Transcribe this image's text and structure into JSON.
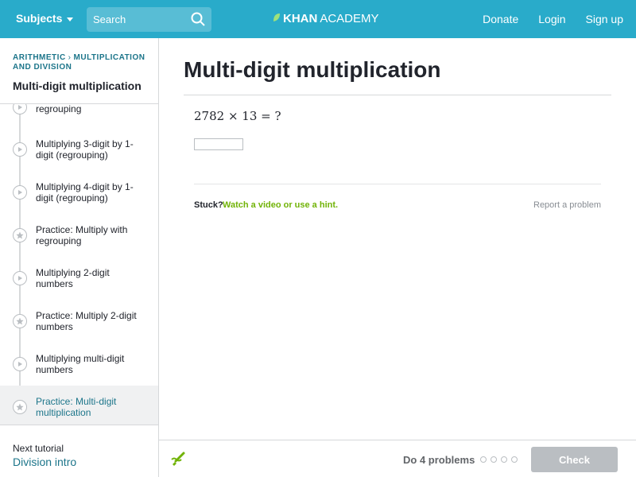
{
  "header": {
    "subjects_label": "Subjects",
    "search_placeholder": "Search",
    "logo_bold": "KHAN",
    "logo_light": "ACADEMY",
    "donate_label": "Donate",
    "login_label": "Login",
    "signup_label": "Sign up",
    "brand_color": "#29abca"
  },
  "sidebar": {
    "breadcrumb_1": "ARITHMETIC",
    "breadcrumb_2": "MULTIPLICATION AND DIVISION",
    "title": "Multi-digit multiplication",
    "items": [
      {
        "label": "regrouping",
        "type": "video"
      },
      {
        "label": "Multiplying 3-digit by 1-digit (regrouping)",
        "type": "video"
      },
      {
        "label": "Multiplying 4-digit by 1-digit (regrouping)",
        "type": "video"
      },
      {
        "label": "Practice: Multiply with regrouping",
        "type": "practice"
      },
      {
        "label": "Multiplying 2-digit numbers",
        "type": "video"
      },
      {
        "label": "Practice: Multiply 2-digit numbers",
        "type": "practice"
      },
      {
        "label": "Multiplying multi-digit numbers",
        "type": "video"
      },
      {
        "label": "Practice: Multi-digit multiplication",
        "type": "practice",
        "active": true
      }
    ],
    "next_tutorial_label": "Next tutorial",
    "next_tutorial_link": "Division intro"
  },
  "main": {
    "title": "Multi-digit multiplication",
    "problem": "2782 × 13 = ?",
    "answer_value": "",
    "stuck_label": "Stuck?",
    "hint_link": "Watch a video or use a hint.",
    "report_label": "Report a problem"
  },
  "footer": {
    "do_problems": "Do 4 problems",
    "progress_dots": 4,
    "check_label": "Check"
  }
}
